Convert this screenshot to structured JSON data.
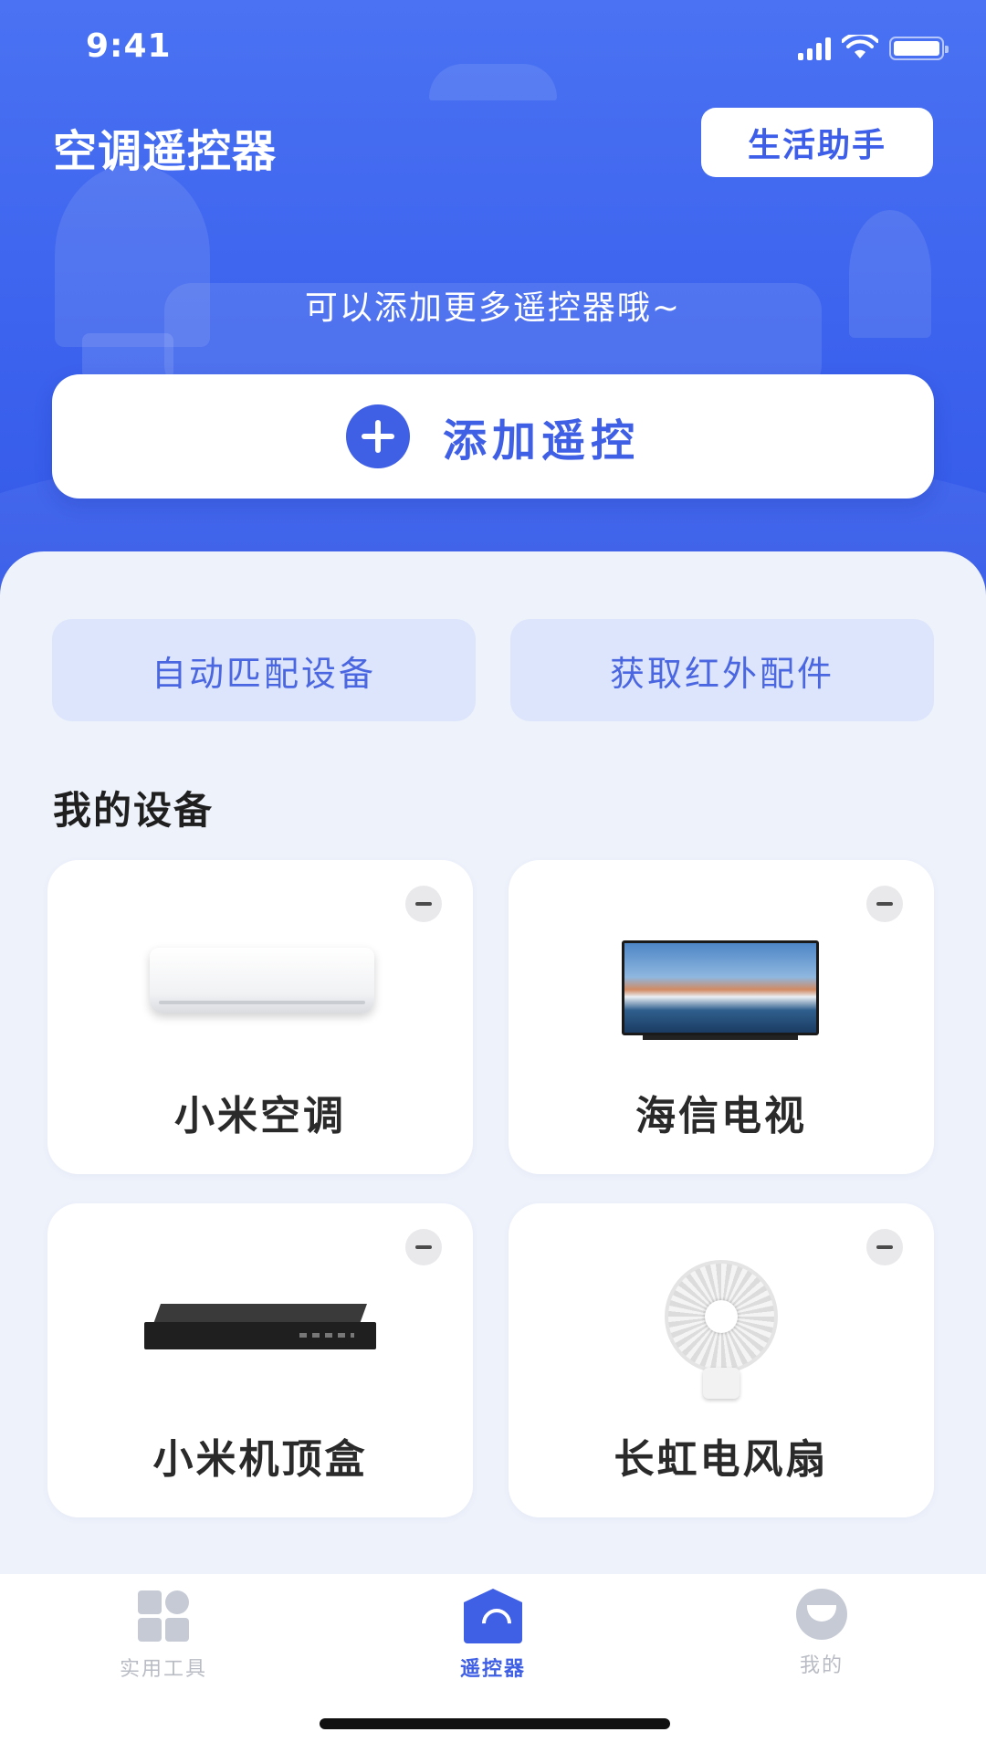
{
  "status": {
    "time": "9:41"
  },
  "header": {
    "title": "空调遥控器",
    "life_button": "生活助手",
    "hint": "可以添加更多遥控器哦~",
    "add_button": "添加遥控"
  },
  "quick_actions": [
    {
      "label": "自动匹配设备"
    },
    {
      "label": "获取红外配件"
    }
  ],
  "devices": {
    "section_title": "我的设备",
    "items": [
      {
        "name": "小米空调",
        "icon": "air-conditioner"
      },
      {
        "name": "海信电视",
        "icon": "television"
      },
      {
        "name": "小米机顶盒",
        "icon": "set-top-box"
      },
      {
        "name": "长虹电风扇",
        "icon": "electric-fan"
      }
    ]
  },
  "tabs": [
    {
      "label": "实用工具",
      "active": false
    },
    {
      "label": "遥控器",
      "active": true
    },
    {
      "label": "我的",
      "active": false
    }
  ],
  "colors": {
    "primary": "#3f5fe5",
    "header_bg": "#4a72f2",
    "soft_blue": "#dce5fb",
    "page_bg": "#eef2fb"
  }
}
